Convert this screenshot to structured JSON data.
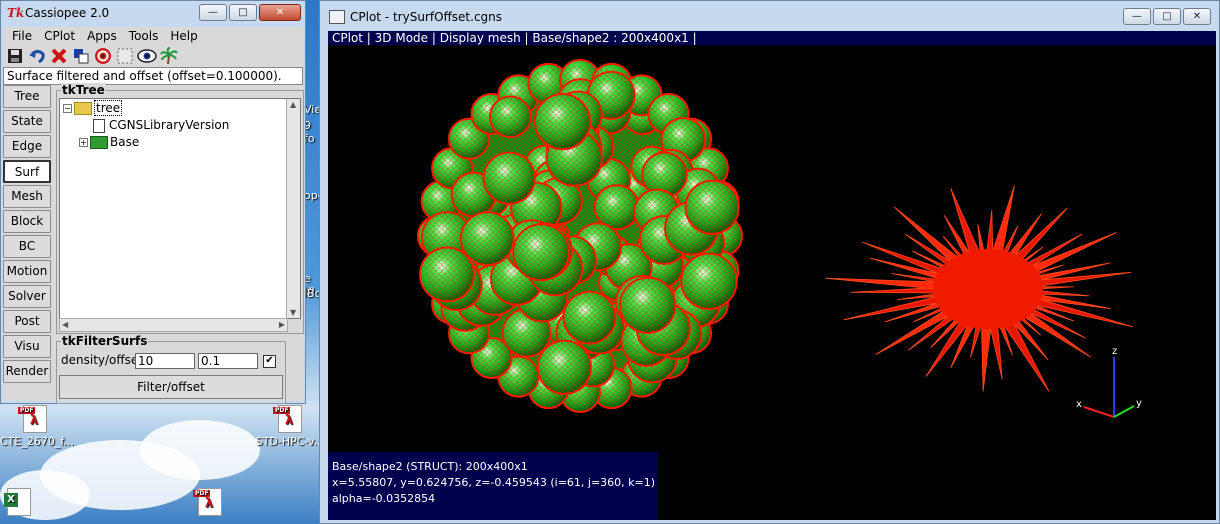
{
  "tk_window": {
    "logo": "Tk",
    "title": "Cassiopee 2.0",
    "menu": [
      "File",
      "CPlot",
      "Apps",
      "Tools",
      "Help"
    ],
    "toolbar_icons": [
      "save-icon",
      "undo-icon",
      "delete-icon",
      "copy-icon",
      "fit-view-icon",
      "select-icon",
      "eye-icon",
      "palm-icon"
    ],
    "status": "Surface filtered and offset (offset=0.100000).",
    "side_buttons": [
      "Tree",
      "State",
      "Edge",
      "Surf",
      "Mesh",
      "Block",
      "BC",
      "Motion",
      "Solver",
      "Post",
      "Visu",
      "Render"
    ],
    "active_side_button": "Surf",
    "tree_panel_label": "tkTree",
    "tree_nodes": {
      "root": "tree",
      "child1": "CGNSLibraryVersion",
      "child2": "Base"
    },
    "filter_panel": {
      "label": "tkFilterSurfs",
      "row_label": "density/offset",
      "density": "10",
      "offset": "0.1",
      "checked": true,
      "button": "Filter/offset"
    }
  },
  "cplot_window": {
    "title": "CPlot - trySurfOffset.cgns",
    "info_bar": "CPlot | 3D Mode | Display mesh | Base/shape2 : 200x400x1 |",
    "info_lines": [
      " Base/shape2 (STRUCT): 200x400x1",
      "x=5.55807, y=0.624756, z=-0.459543 (i=61, j=360,  k=1)",
      "alpha=-0.0352854"
    ],
    "axis_labels": {
      "x": "x",
      "y": "y",
      "z": "z"
    },
    "colors": {
      "surface_green": "#19c41c",
      "mesh_red": "#ff1a00",
      "background": "#000000",
      "info_bg": "#00004d"
    }
  },
  "desktop": {
    "icons": [
      "CTE_2670_f...",
      "STD-HPC-v..."
    ],
    "partial_labels": [
      "Vie",
      "9 fo",
      "ope",
      "e VI",
      "lBo"
    ]
  }
}
